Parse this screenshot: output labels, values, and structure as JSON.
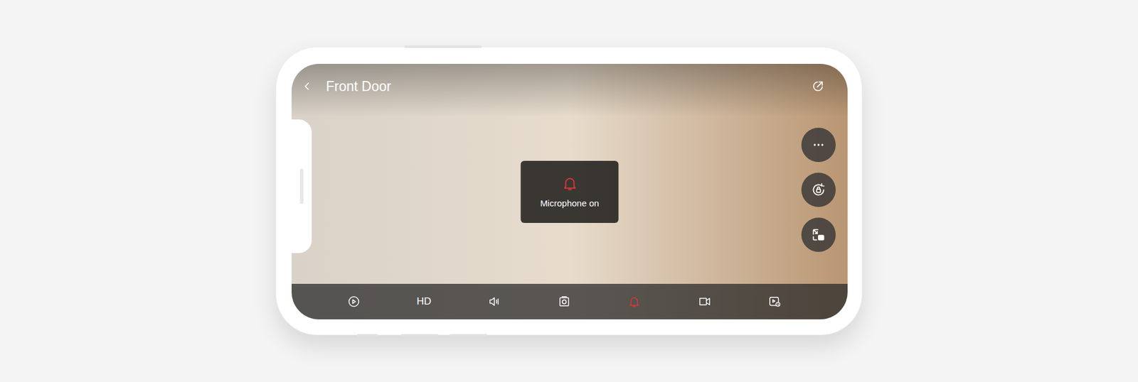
{
  "camera": {
    "title": "Front Door"
  },
  "toast": {
    "label": "Microphone on"
  },
  "toolbar": [
    {
      "kind": "playback",
      "selected": false
    },
    {
      "kind": "quality",
      "label": "HD",
      "selected": false
    },
    {
      "kind": "speaker",
      "selected": false
    },
    {
      "kind": "snapshot",
      "selected": false
    },
    {
      "kind": "talk",
      "selected": true
    },
    {
      "kind": "record",
      "selected": false
    },
    {
      "kind": "history",
      "selected": false
    }
  ]
}
